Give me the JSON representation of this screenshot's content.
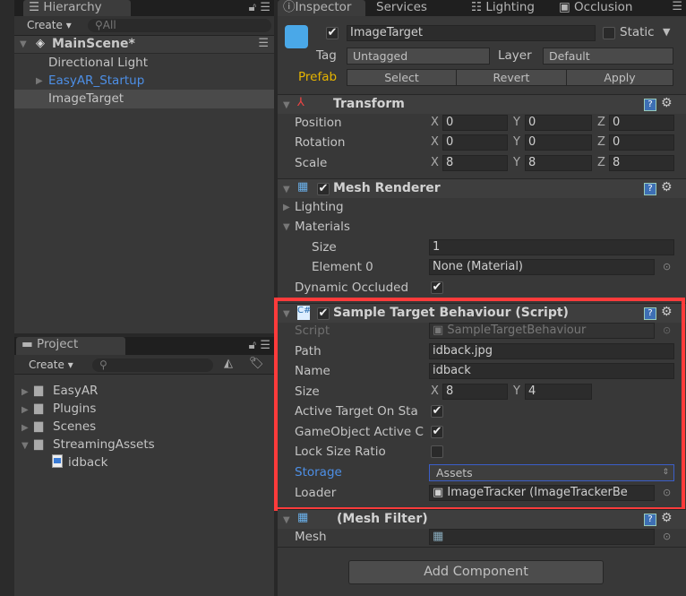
{
  "hierarchy": {
    "tab": "Hierarchy",
    "create": "Create ▾",
    "search_placeholder": "All",
    "scene": "MainScene*",
    "items": [
      {
        "label": "Directional Light"
      },
      {
        "label": "EasyAR_Startup",
        "color": "#4d8fe6"
      },
      {
        "label": "ImageTarget",
        "selected": true
      }
    ]
  },
  "project": {
    "tab": "Project",
    "create": "Create ▾",
    "items": [
      {
        "label": "EasyAR"
      },
      {
        "label": "Plugins"
      },
      {
        "label": "Scenes"
      },
      {
        "label": "StreamingAssets"
      },
      {
        "label": "idback"
      }
    ]
  },
  "inspector": {
    "tabs": [
      "Inspector",
      "Services",
      "Lighting",
      "Occlusion"
    ],
    "object_name": "ImageTarget",
    "active": true,
    "static_label": "Static",
    "static": false,
    "tag_label": "Tag",
    "tag": "Untagged",
    "layer_label": "Layer",
    "layer": "Default",
    "prefab_label": "Prefab",
    "prefab_color": "#e6b400",
    "select": "Select",
    "revert": "Revert",
    "apply": "Apply",
    "transform": {
      "title": "Transform",
      "rows": [
        {
          "label": "Position",
          "x": "0",
          "y": "0",
          "z": "0"
        },
        {
          "label": "Rotation",
          "x": "0",
          "y": "0",
          "z": "0"
        },
        {
          "label": "Scale",
          "x": "8",
          "y": "8",
          "z": "8"
        }
      ]
    },
    "mesh_renderer": {
      "title": "Mesh Renderer",
      "lighting": "Lighting",
      "materials": "Materials",
      "size_label": "Size",
      "size": "1",
      "element0_label": "Element 0",
      "element0": "None (Material)",
      "dynamic_occluded": "Dynamic Occluded"
    },
    "sample": {
      "title": "Sample Target Behaviour (Script)",
      "script_label": "Script",
      "script": "SampleTargetBehaviour",
      "path_label": "Path",
      "path": "idback.jpg",
      "name_label": "Name",
      "name": "idback",
      "size_label": "Size",
      "size_x": "8",
      "size_y": "4",
      "active_target": "Active Target On Sta",
      "gameobject_active": "GameObject Active C",
      "lock_size": "Lock Size Ratio",
      "storage_label": "Storage",
      "storage": "Assets",
      "loader_label": "Loader",
      "loader": "ImageTracker (ImageTrackerBe"
    },
    "mesh_filter": {
      "title": "(Mesh Filter)",
      "mesh_label": "Mesh"
    },
    "add_component": "Add Component",
    "highlight_color": "#ff3b3b"
  },
  "axis": {
    "x": "X",
    "y": "Y",
    "z": "Z"
  }
}
